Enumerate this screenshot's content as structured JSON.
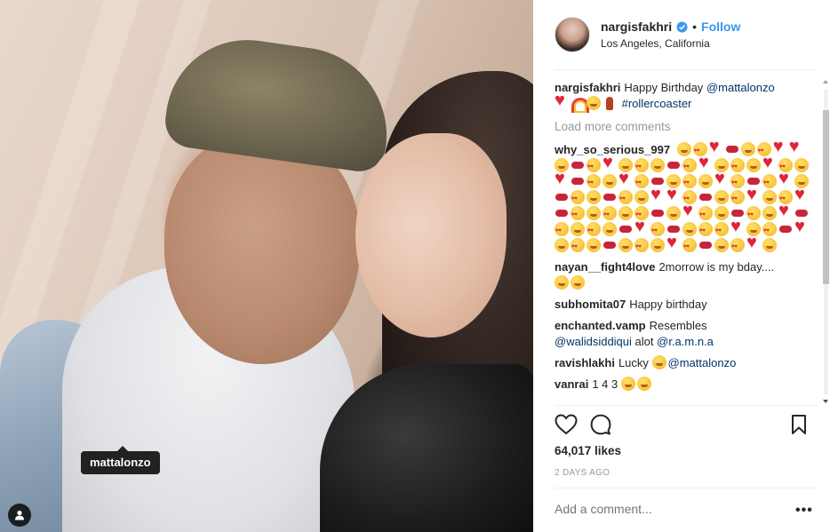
{
  "photo": {
    "tag_label": "mattalonzo"
  },
  "header": {
    "username": "nargisfakhri",
    "separator": "•",
    "follow_label": "Follow",
    "location": "Los Angeles, California",
    "verified": true
  },
  "caption": {
    "user": "nargisfakhri",
    "text": "Happy Birthday",
    "mention": "@mattalonzo",
    "emojis": [
      "heart-icon",
      "rainbow-icon",
      "kiss-face-icon",
      "dancer-icon"
    ],
    "hashtag": "#rollercoaster"
  },
  "load_more_label": "Load more comments",
  "comments": [
    {
      "user": "why_so_serious_997",
      "text": ""
    },
    {
      "user": "nayan__fight4love",
      "text": "2morrow is my bday...."
    },
    {
      "user": "subhomita07",
      "text": "Happy birthday"
    },
    {
      "user": "enchanted.vamp",
      "text": "Resembles",
      "mention1": "@walidsiddiqui",
      "mid": "alot",
      "mention2": "@r.a.m.n.a"
    },
    {
      "user": "ravishlakhi",
      "text": "Lucky",
      "mention": "@mattalonzo"
    },
    {
      "user": "vanrai",
      "text": "1 4 3"
    }
  ],
  "likes": "64,017 likes",
  "timestamp": "2 DAYS AGO",
  "add_comment_placeholder": "Add a comment...",
  "more_label": "•••"
}
